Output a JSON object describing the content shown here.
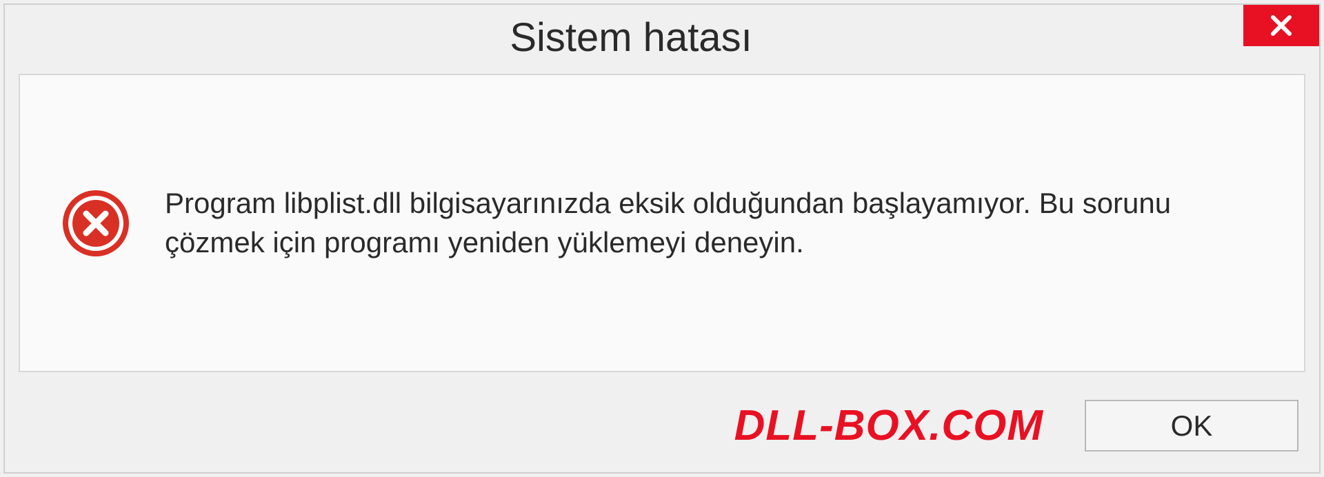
{
  "dialog": {
    "title": "Sistem hatası",
    "message": "Program libplist.dll bilgisayarınızda eksik olduğundan başlayamıyor. Bu sorunu çözmek için programı yeniden yüklemeyi deneyin.",
    "ok_label": "OK",
    "watermark": "DLL-BOX.COM"
  }
}
